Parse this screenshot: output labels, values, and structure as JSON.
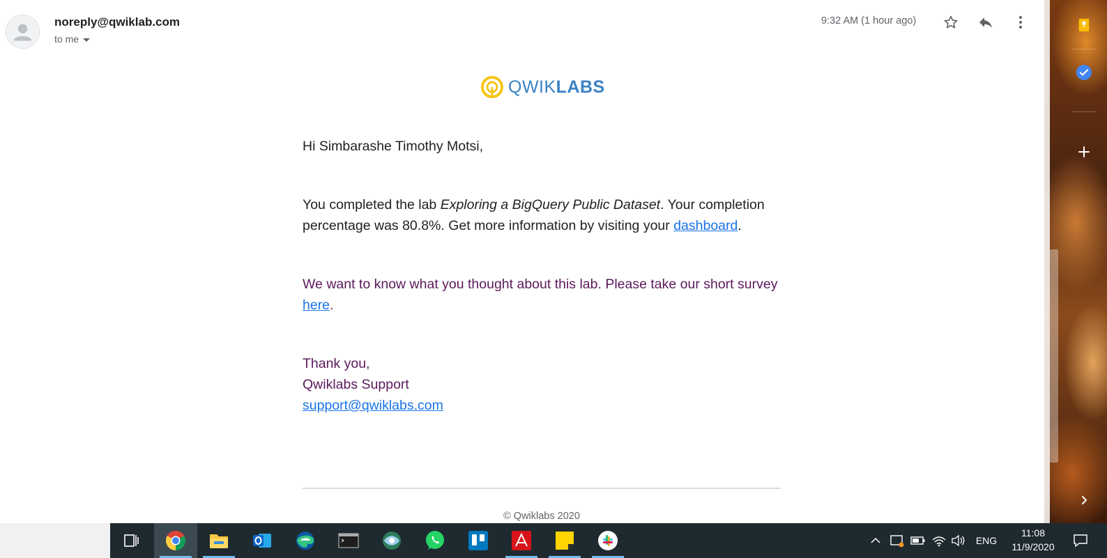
{
  "email": {
    "sender": "noreply@qwiklab.com",
    "recipient_label": "to me",
    "timestamp": "9:32 AM (1 hour ago)",
    "logo_text_light": "QWIK",
    "logo_text_bold": "LABS",
    "greeting": "Hi Simbarashe Timothy Motsi,",
    "completion_prefix": "You completed the lab ",
    "lab_name": "Exploring a BigQuery Public Dataset",
    "completion_middle": ". Your completion percentage was 80.8%. Get more information by visiting your ",
    "dashboard_link": "dashboard",
    "completion_end": ".",
    "survey_prefix": "We want to know what you thought about this lab. Please take our short survey ",
    "survey_link": "here",
    "survey_end": ".",
    "sign_thanks": "Thank you,",
    "sign_team": "Qwiklabs Support",
    "sign_email": "support@qwiklabs.com",
    "footer": "© Qwiklabs 2020"
  },
  "header_icons": [
    "star-icon",
    "reply-icon",
    "more-vert-icon"
  ],
  "side_panel_icons": [
    "keep-icon",
    "tasks-icon",
    "add-icon",
    "expand-panel-icon"
  ],
  "taskbar": {
    "apps": [
      "task-view-icon",
      "chrome-icon",
      "file-explorer-icon",
      "outlook-icon",
      "edge-icon",
      "terminal-icon",
      "network-app-icon",
      "whatsapp-icon",
      "trello-icon",
      "acrobat-icon",
      "sticky-notes-icon",
      "slack-icon"
    ],
    "language": "ENG",
    "time": "11:08",
    "date": "11/9/2020"
  },
  "colors": {
    "link": "#1a73e8",
    "quoted_text": "#5c1a5c",
    "logo_blue": "#3b82c4",
    "logo_yellow": "#f5c518",
    "taskbar": "#1e2a2f"
  }
}
